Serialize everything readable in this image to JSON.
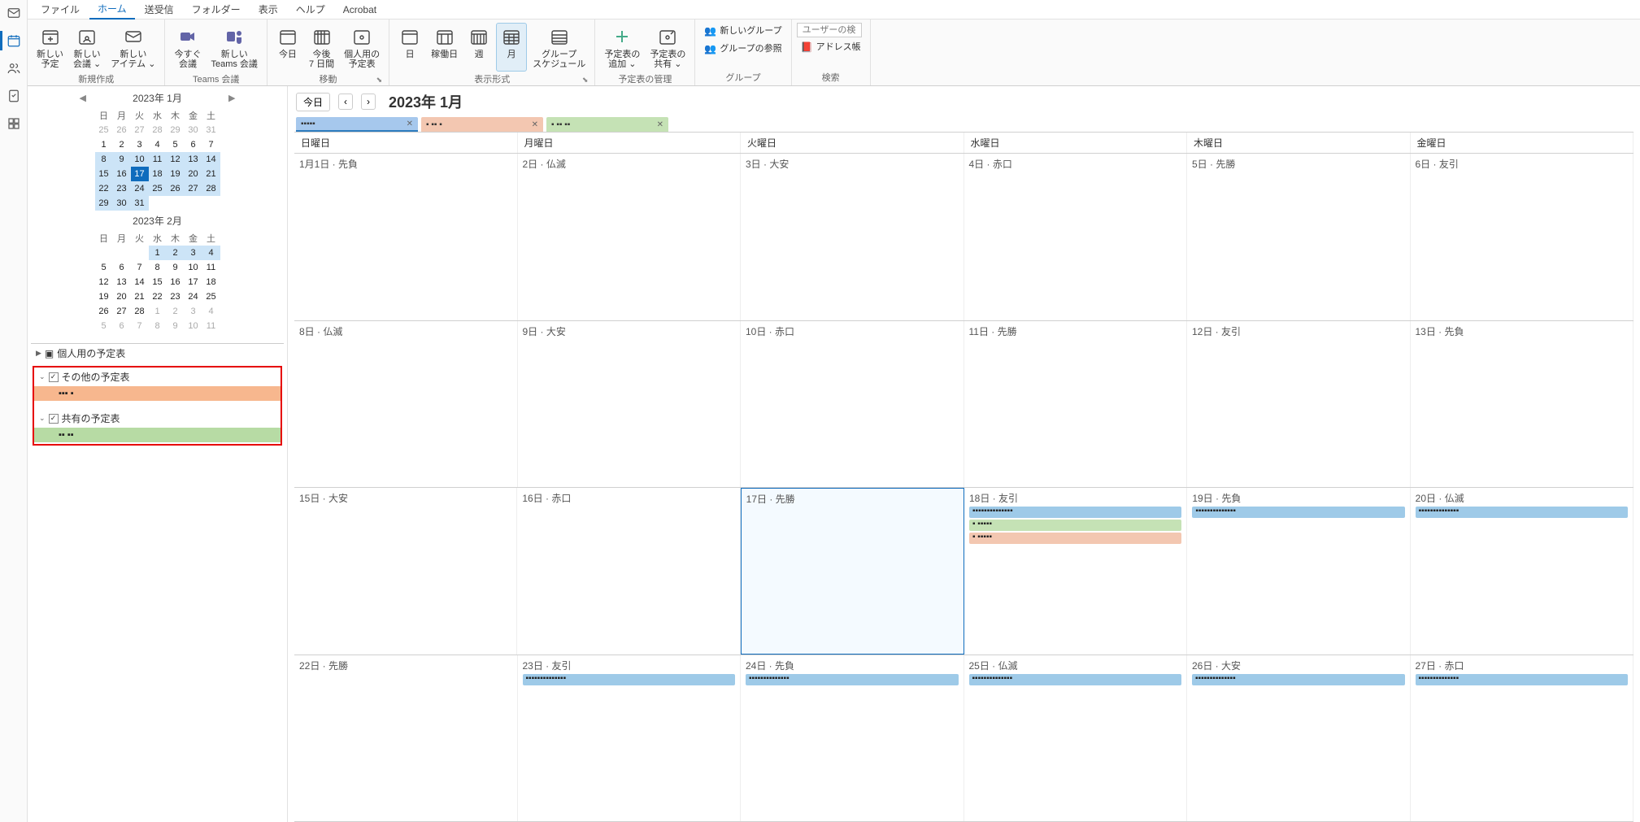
{
  "tabs": {
    "file": "ファイル",
    "home": "ホーム",
    "sendreceive": "送受信",
    "folder": "フォルダー",
    "view": "表示",
    "help": "ヘルプ",
    "acrobat": "Acrobat"
  },
  "ribbon": {
    "new_event": "新しい\n予定",
    "new_meeting": "新しい\n会議 ⌄",
    "new_items": "新しい\nアイテム ⌄",
    "group_new": "新規作成",
    "meet_now": "今すぐ\n会議",
    "teams_meeting": "新しい\nTeams 会議",
    "group_teams": "Teams 会議",
    "today": "今日",
    "next7": "今後\n7 日間",
    "personal": "個人用の\n予定表",
    "group_move": "移動",
    "day": "日",
    "workweek": "稼働日",
    "week": "週",
    "month": "月",
    "schedule": "グループ\nスケジュール",
    "group_display": "表示形式",
    "add_cal": "予定表の\n追加 ⌄",
    "share_cal": "予定表の\n共有 ⌄",
    "group_manage": "予定表の管理",
    "new_group": "新しいグループ",
    "browse_groups": "グループの参照",
    "group_groups": "グループ",
    "search_placeholder": "ユーザーの検索",
    "address_book": "アドレス帳",
    "group_search": "検索"
  },
  "minical1": {
    "title": "2023年 1月",
    "dow": [
      "日",
      "月",
      "火",
      "水",
      "木",
      "金",
      "土"
    ],
    "rows": [
      [
        {
          "n": "25",
          "d": 1
        },
        {
          "n": "26",
          "d": 1
        },
        {
          "n": "27",
          "d": 1
        },
        {
          "n": "28",
          "d": 1
        },
        {
          "n": "29",
          "d": 1
        },
        {
          "n": "30",
          "d": 1
        },
        {
          "n": "31",
          "d": 1
        }
      ],
      [
        {
          "n": "1"
        },
        {
          "n": "2"
        },
        {
          "n": "3"
        },
        {
          "n": "4"
        },
        {
          "n": "5"
        },
        {
          "n": "6"
        },
        {
          "n": "7"
        }
      ],
      [
        {
          "n": "8",
          "r": 1
        },
        {
          "n": "9",
          "r": 1
        },
        {
          "n": "10",
          "r": 1
        },
        {
          "n": "11",
          "r": 1
        },
        {
          "n": "12",
          "r": 1
        },
        {
          "n": "13",
          "r": 1
        },
        {
          "n": "14",
          "r": 1
        }
      ],
      [
        {
          "n": "15",
          "r": 1
        },
        {
          "n": "16",
          "r": 1
        },
        {
          "n": "17",
          "t": 1
        },
        {
          "n": "18",
          "r": 1
        },
        {
          "n": "19",
          "r": 1
        },
        {
          "n": "20",
          "r": 1
        },
        {
          "n": "21",
          "r": 1
        }
      ],
      [
        {
          "n": "22",
          "r": 1
        },
        {
          "n": "23",
          "r": 1
        },
        {
          "n": "24",
          "r": 1
        },
        {
          "n": "25",
          "r": 1
        },
        {
          "n": "26",
          "r": 1
        },
        {
          "n": "27",
          "r": 1
        },
        {
          "n": "28",
          "r": 1
        }
      ],
      [
        {
          "n": "29",
          "r": 1
        },
        {
          "n": "30",
          "r": 1
        },
        {
          "n": "31",
          "r": 1
        },
        {
          "n": ""
        },
        {
          "n": ""
        },
        {
          "n": ""
        },
        {
          "n": ""
        }
      ]
    ]
  },
  "minical2": {
    "title": "2023年 2月",
    "dow": [
      "日",
      "月",
      "火",
      "水",
      "木",
      "金",
      "土"
    ],
    "rows": [
      [
        {
          "n": ""
        },
        {
          "n": ""
        },
        {
          "n": ""
        },
        {
          "n": "1",
          "r": 1
        },
        {
          "n": "2",
          "r": 1
        },
        {
          "n": "3",
          "r": 1
        },
        {
          "n": "4",
          "r": 1
        }
      ],
      [
        {
          "n": "5"
        },
        {
          "n": "6"
        },
        {
          "n": "7"
        },
        {
          "n": "8"
        },
        {
          "n": "9"
        },
        {
          "n": "10"
        },
        {
          "n": "11"
        }
      ],
      [
        {
          "n": "12"
        },
        {
          "n": "13"
        },
        {
          "n": "14"
        },
        {
          "n": "15"
        },
        {
          "n": "16"
        },
        {
          "n": "17"
        },
        {
          "n": "18"
        }
      ],
      [
        {
          "n": "19"
        },
        {
          "n": "20"
        },
        {
          "n": "21"
        },
        {
          "n": "22"
        },
        {
          "n": "23"
        },
        {
          "n": "24"
        },
        {
          "n": "25"
        }
      ],
      [
        {
          "n": "26"
        },
        {
          "n": "27"
        },
        {
          "n": "28"
        },
        {
          "n": "1",
          "d": 1
        },
        {
          "n": "2",
          "d": 1
        },
        {
          "n": "3",
          "d": 1
        },
        {
          "n": "4",
          "d": 1
        }
      ],
      [
        {
          "n": "5",
          "d": 1
        },
        {
          "n": "6",
          "d": 1
        },
        {
          "n": "7",
          "d": 1
        },
        {
          "n": "8",
          "d": 1
        },
        {
          "n": "9",
          "d": 1
        },
        {
          "n": "10",
          "d": 1
        },
        {
          "n": "11",
          "d": 1
        }
      ]
    ]
  },
  "sidebar": {
    "my_calendars": "個人用の予定表",
    "other_calendars": "その他の予定表",
    "other_item": "▪▪▪ ▪",
    "shared_calendars": "共有の予定表",
    "shared_item": "▪▪ ▪▪"
  },
  "calview": {
    "today_btn": "今日",
    "month_title": "2023年 1月",
    "overlay_tabs": [
      "▪▪▪▪▪",
      "▪ ▪▪ ▪",
      "▪ ▪▪ ▪▪"
    ],
    "dow": [
      "日曜日",
      "月曜日",
      "火曜日",
      "水曜日",
      "木曜日",
      "金曜日"
    ],
    "weeks": [
      [
        {
          "label": "1月1日 · 先負"
        },
        {
          "label": "2日 · 仏滅"
        },
        {
          "label": "3日 · 大安"
        },
        {
          "label": "4日 · 赤口"
        },
        {
          "label": "5日 · 先勝"
        },
        {
          "label": "6日 · 友引"
        }
      ],
      [
        {
          "label": "8日 · 仏滅"
        },
        {
          "label": "9日 · 大安"
        },
        {
          "label": "10日 · 赤口"
        },
        {
          "label": "11日 · 先勝"
        },
        {
          "label": "12日 · 友引"
        },
        {
          "label": "13日 · 先負"
        }
      ],
      [
        {
          "label": "15日 · 大安"
        },
        {
          "label": "16日 · 赤口"
        },
        {
          "label": "17日 · 先勝",
          "today": true
        },
        {
          "label": "18日 · 友引",
          "events": [
            {
              "c": "blue",
              "t": "▪▪▪▪▪▪▪▪▪▪▪▪▪▪"
            },
            {
              "c": "green",
              "t": "▪ ▪▪▪▪▪"
            },
            {
              "c": "orange",
              "t": "▪ ▪▪▪▪▪"
            }
          ]
        },
        {
          "label": "19日 · 先負",
          "events": [
            {
              "c": "blue",
              "t": "▪▪▪▪▪▪▪▪▪▪▪▪▪▪"
            }
          ]
        },
        {
          "label": "20日 · 仏滅",
          "events": [
            {
              "c": "blue",
              "t": "▪▪▪▪▪▪▪▪▪▪▪▪▪▪"
            }
          ]
        }
      ],
      [
        {
          "label": "22日 · 先勝"
        },
        {
          "label": "23日 · 友引",
          "events": [
            {
              "c": "blue",
              "t": "▪▪▪▪▪▪▪▪▪▪▪▪▪▪"
            }
          ]
        },
        {
          "label": "24日 · 先負",
          "events": [
            {
              "c": "blue",
              "t": "▪▪▪▪▪▪▪▪▪▪▪▪▪▪"
            }
          ]
        },
        {
          "label": "25日 · 仏滅",
          "events": [
            {
              "c": "blue",
              "t": "▪▪▪▪▪▪▪▪▪▪▪▪▪▪"
            }
          ]
        },
        {
          "label": "26日 · 大安",
          "events": [
            {
              "c": "blue",
              "t": "▪▪▪▪▪▪▪▪▪▪▪▪▪▪"
            }
          ]
        },
        {
          "label": "27日 · 赤口",
          "events": [
            {
              "c": "blue",
              "t": "▪▪▪▪▪▪▪▪▪▪▪▪▪▪"
            }
          ]
        }
      ]
    ]
  }
}
